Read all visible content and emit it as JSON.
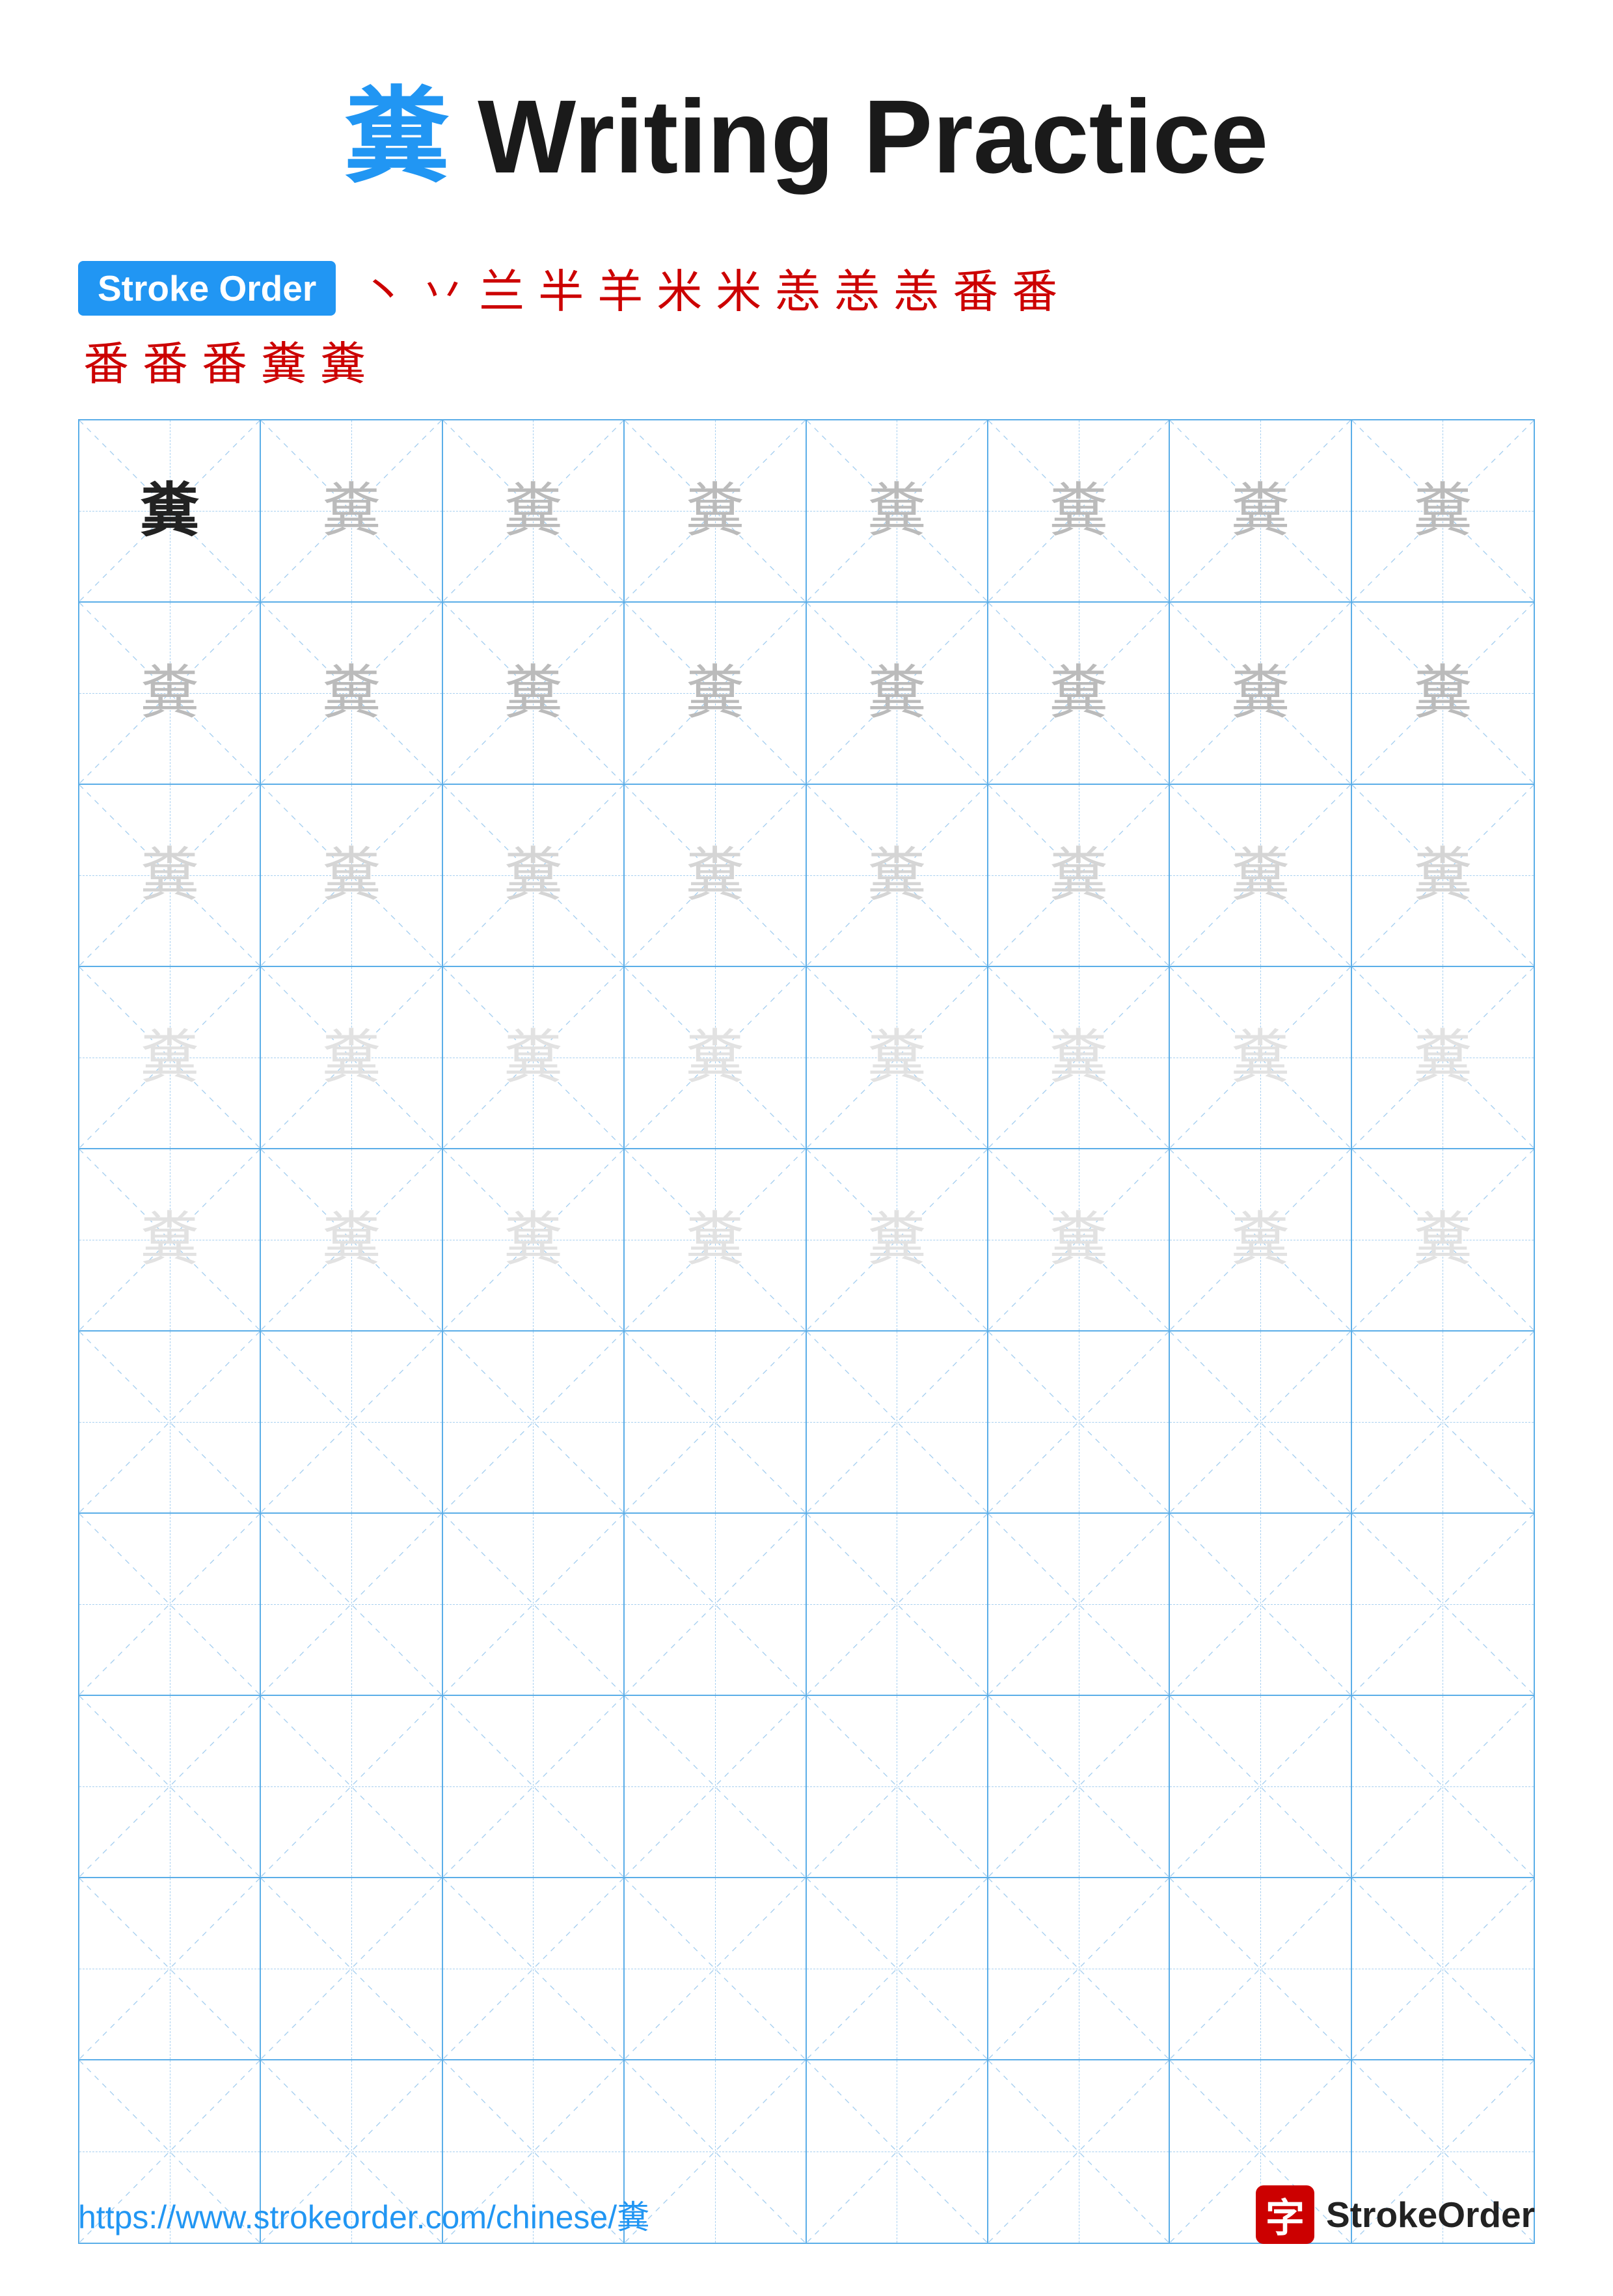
{
  "title": {
    "char": "糞",
    "label": "Writing Practice",
    "full": "糞 Writing Practice"
  },
  "stroke_order": {
    "badge_label": "Stroke Order",
    "strokes_row1": [
      "丶",
      "丷",
      "兰",
      "半",
      "羊",
      "米",
      "米",
      "恙",
      "恙",
      "恙",
      "番",
      "番"
    ],
    "strokes_row2": [
      "番",
      "番",
      "番",
      "糞",
      "糞"
    ]
  },
  "practice_char": "糞",
  "grid": {
    "cols": 8,
    "rows": [
      {
        "type": "practice",
        "cells": [
          "dark",
          "medium",
          "medium",
          "medium",
          "medium",
          "medium",
          "medium",
          "medium"
        ]
      },
      {
        "type": "practice",
        "cells": [
          "medium",
          "medium",
          "medium",
          "medium",
          "medium",
          "medium",
          "medium",
          "medium"
        ]
      },
      {
        "type": "practice",
        "cells": [
          "light",
          "light",
          "light",
          "light",
          "light",
          "light",
          "light",
          "light"
        ]
      },
      {
        "type": "practice",
        "cells": [
          "lighter",
          "lighter",
          "lighter",
          "lighter",
          "lighter",
          "lighter",
          "lighter",
          "lighter"
        ]
      },
      {
        "type": "practice",
        "cells": [
          "lighter",
          "lighter",
          "lighter",
          "lighter",
          "lighter",
          "lighter",
          "lighter",
          "lighter"
        ]
      },
      {
        "type": "empty",
        "cells": [
          "empty",
          "empty",
          "empty",
          "empty",
          "empty",
          "empty",
          "empty",
          "empty"
        ]
      },
      {
        "type": "empty",
        "cells": [
          "empty",
          "empty",
          "empty",
          "empty",
          "empty",
          "empty",
          "empty",
          "empty"
        ]
      },
      {
        "type": "empty",
        "cells": [
          "empty",
          "empty",
          "empty",
          "empty",
          "empty",
          "empty",
          "empty",
          "empty"
        ]
      },
      {
        "type": "empty",
        "cells": [
          "empty",
          "empty",
          "empty",
          "empty",
          "empty",
          "empty",
          "empty",
          "empty"
        ]
      },
      {
        "type": "empty",
        "cells": [
          "empty",
          "empty",
          "empty",
          "empty",
          "empty",
          "empty",
          "empty",
          "empty"
        ]
      }
    ]
  },
  "footer": {
    "url": "https://www.strokeorder.com/chinese/糞",
    "logo_char": "字",
    "logo_text": "StrokeOrder"
  }
}
